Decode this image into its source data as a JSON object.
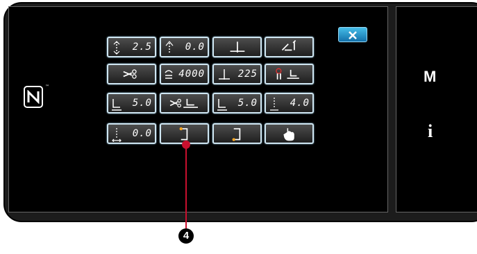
{
  "panel": {
    "close_label": "×",
    "nfc_tm": "™",
    "side": {
      "menu_label": "M",
      "info_label": "i"
    }
  },
  "buttons": {
    "row1": [
      "2.5",
      "0.0",
      "",
      ""
    ],
    "row2": [
      "",
      "4000",
      "225",
      ""
    ],
    "row3": [
      "5.0",
      "",
      "5.0",
      "4.0"
    ],
    "row4": [
      "0.0",
      "",
      "",
      ""
    ]
  },
  "icons": {
    "stitch_length": "stitch-length-icon",
    "reverse_stitch": "reverse-stitch-icon",
    "needle_up_down": "needle-up-down-icon",
    "presser_foot_lift": "presser-foot-lift-icon",
    "thread_trimmer": "thread-trimmer-icon",
    "bobbin_counter": "bobbin-counter-icon",
    "needle_position": "needle-position-icon",
    "presser_foot_stop": "presser-foot-stop-icon",
    "trim_foot": "trim-foot-icon",
    "hand_pointer": "hand-pointer-icon"
  },
  "callout": {
    "number": "4"
  },
  "colors": {
    "accent_blue": "#2a94d0",
    "marker_orange": "#f5a623",
    "callout_red": "#c8102e"
  }
}
